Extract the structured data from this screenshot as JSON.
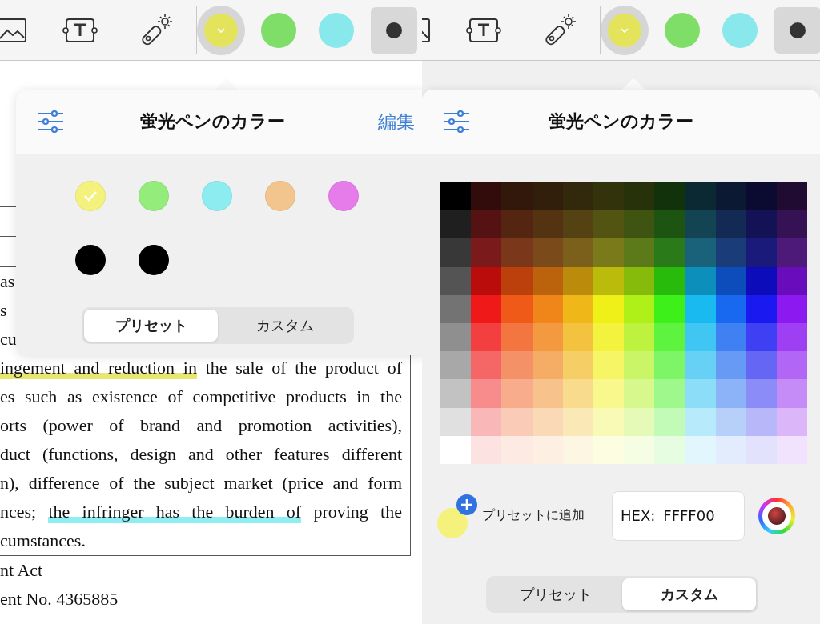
{
  "left_screen": {
    "toolbar": {
      "tools": [
        {
          "kind": "image"
        },
        {
          "kind": "text-box"
        },
        {
          "kind": "wand"
        }
      ],
      "pens": [
        {
          "kind": "color",
          "color": "#e4e45c",
          "selected": true
        },
        {
          "kind": "color",
          "color": "#7ede68",
          "selected": false
        },
        {
          "kind": "color",
          "color": "#88e8ec",
          "selected": false
        },
        {
          "kind": "size",
          "selected": true
        }
      ]
    },
    "document": {
      "fragments": [
        "as",
        "s",
        "cu"
      ],
      "lines": [
        {
          "parts": [
            {
              "text": "ingement and reduction in",
              "color": "#e8e66e"
            },
            {
              "text": " the sale of the product of"
            }
          ]
        },
        {
          "parts": [
            {
              "text": "es such as existence of competitive products in the"
            }
          ]
        },
        {
          "parts": [
            {
              "text": "orts (power of brand and promotion activities),"
            }
          ]
        },
        {
          "parts": [
            {
              "text": "duct (functions, design and other features different"
            }
          ]
        },
        {
          "parts": [
            {
              "text": "n), difference of the subject market (price and form"
            }
          ]
        },
        {
          "parts": [
            {
              "text": "nces; "
            },
            {
              "text": "the infringer has the burden of",
              "color": "#8eeef2"
            },
            {
              "text": " proving the"
            }
          ]
        },
        {
          "parts": [
            {
              "text": "cumstances."
            }
          ]
        }
      ],
      "after_lines": [
        "nt Act",
        "ent No. 4365885"
      ]
    },
    "popover": {
      "title": "蛍光ペンのカラー",
      "edit": "編集",
      "swatches": [
        {
          "color": "#f4f27c",
          "selected": true
        },
        {
          "color": "#94ec7a",
          "selected": false
        },
        {
          "color": "#8cecf0",
          "selected": false
        },
        {
          "color": "#f2c58e",
          "selected": false
        },
        {
          "color": "#e67cea",
          "selected": false
        },
        {
          "color": "#000000",
          "selected": false
        },
        {
          "color": "#000000",
          "selected": false
        }
      ],
      "segments": [
        {
          "label": "プリセット",
          "selected": true
        },
        {
          "label": "カスタム",
          "selected": false
        }
      ]
    }
  },
  "right_screen": {
    "toolbar": {
      "tools": [
        {
          "kind": "image"
        },
        {
          "kind": "text-box"
        },
        {
          "kind": "wand"
        }
      ],
      "pens": [
        {
          "kind": "color",
          "color": "#e4e45c",
          "selected": true
        },
        {
          "kind": "color",
          "color": "#7ede68",
          "selected": false
        },
        {
          "kind": "color",
          "color": "#88e8ec",
          "selected": false
        },
        {
          "kind": "size",
          "selected": true
        }
      ]
    },
    "popover": {
      "title": "蛍光ペンのカラー",
      "preview": {
        "color": "#f4f27c"
      },
      "add_label": "プリセットに追加",
      "hex_label": "HEX:",
      "hex_value": "FFFF00",
      "segments": [
        {
          "label": "プリセット",
          "selected": false
        },
        {
          "label": "カスタム",
          "selected": true
        }
      ]
    }
  }
}
